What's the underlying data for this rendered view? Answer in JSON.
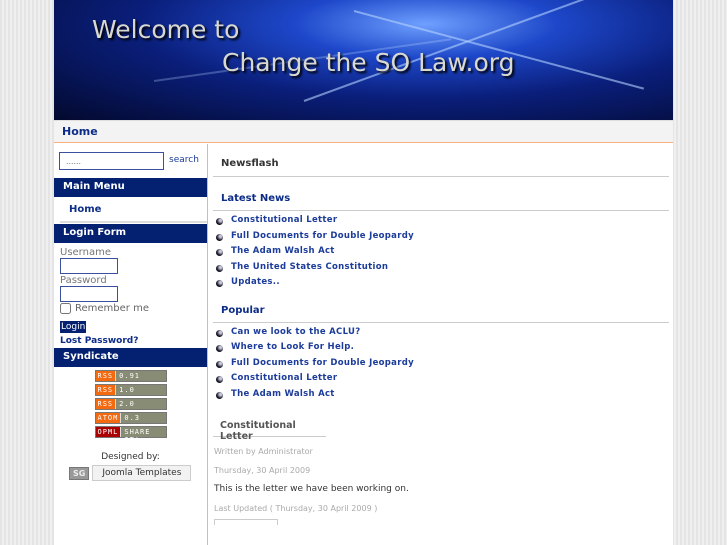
{
  "header": {
    "line1": "Welcome to",
    "line2": "Change the SO Law.org"
  },
  "nav": {
    "home": "Home"
  },
  "search": {
    "placeholder": "......",
    "button": "search"
  },
  "main_menu": {
    "title": "Main Menu",
    "items": [
      "Home"
    ]
  },
  "login": {
    "title": "Login Form",
    "username_label": "Username",
    "password_label": "Password",
    "remember": "Remember me",
    "button": "Login",
    "lost": "Lost Password?"
  },
  "syndicate": {
    "title": "Syndicate",
    "feeds": [
      [
        "RSS",
        "0.91"
      ],
      [
        "RSS",
        "1.0"
      ],
      [
        "RSS",
        "2.0"
      ],
      [
        "ATOM",
        "0.3"
      ],
      [
        "OPML",
        "SHARE IT!"
      ]
    ]
  },
  "designed": {
    "label": "Designed by:",
    "logo": "SG",
    "button": "Joomla Templates"
  },
  "newsflash": {
    "title": "Newsflash"
  },
  "latest": {
    "title": "Latest News",
    "items": [
      "Constitutional Letter",
      "Full Documents for Double Jeopardy",
      "The Adam Walsh Act",
      "The United States Constitution",
      "Updates.."
    ]
  },
  "popular": {
    "title": "Popular",
    "items": [
      "Can we look to the ACLU?",
      "Where to Look For Help.",
      "Full Documents for Double Jeopardy",
      "Constitutional Letter",
      "The Adam Walsh Act"
    ]
  },
  "article": {
    "title": "Constitutional Letter",
    "author": "Written by Administrator",
    "date": "Thursday, 30 April 2009",
    "body": "This is the letter we have been working on.",
    "updated": "Last Updated ( Thursday, 30 April 2009 )"
  }
}
